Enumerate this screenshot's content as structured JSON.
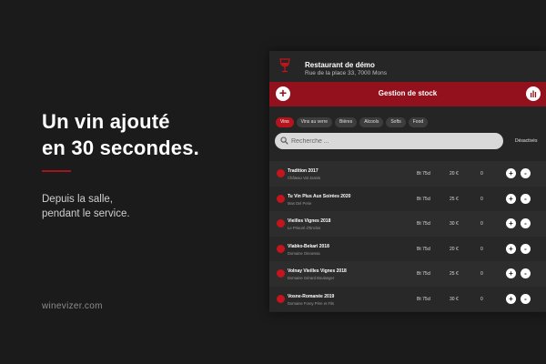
{
  "promo": {
    "headline": [
      "Un vin ajouté",
      "en 30 secondes."
    ],
    "subtext": [
      "Depuis la salle,",
      "pendant le service."
    ],
    "site": "winevizer.com",
    "accent_color": "#a4141e"
  },
  "app": {
    "restaurant_name": "Restaurant de démo",
    "restaurant_address": "Rue de la place 33, 7000 Mons",
    "title": "Gestion de stock",
    "add_label": "+",
    "brand_color": "#93111c",
    "icons": {
      "add": "plus-icon",
      "stats": "bar-chart-icon",
      "search": "search-icon",
      "logo": "wine-glass-icon"
    },
    "categories": [
      {
        "label": "Vins",
        "active": true
      },
      {
        "label": "Vins au verre",
        "active": false
      },
      {
        "label": "Bières",
        "active": false
      },
      {
        "label": "Alcools",
        "active": false
      },
      {
        "label": "Softs",
        "active": false
      },
      {
        "label": "Food",
        "active": false
      }
    ],
    "search": {
      "placeholder": "Recherche ..."
    },
    "deactivate_label": "Désactivés",
    "wines": [
      {
        "name": "Tradition 2017",
        "producer": "Château Val Joanis",
        "size": "Bt 75cl",
        "price": "20 €",
        "qty": "0"
      },
      {
        "name": "Tu Vin Plus Aux Soirées 2020",
        "producer": "Mas Del Perie",
        "size": "Bt 75cl",
        "price": "25 €",
        "qty": "0"
      },
      {
        "name": "Vieilles Vignes 2018",
        "producer": "Le Prieuré d'Enclos",
        "size": "Bt 75cl",
        "price": "30 €",
        "qty": "0"
      },
      {
        "name": "Vlabko-Bekari 2018",
        "producer": "Domaine Oinoessa",
        "size": "Bt 75cl",
        "price": "20 €",
        "qty": "0"
      },
      {
        "name": "Volnay Vieilles Vignes 2018",
        "producer": "Domaine Gérard Boulanger",
        "size": "Bt 75cl",
        "price": "25 €",
        "qty": "0"
      },
      {
        "name": "Vosne-Romanée 2019",
        "producer": "Domaine Forey Père et Fils",
        "size": "Bt 75cl",
        "price": "30 €",
        "qty": "0"
      }
    ],
    "row_plus": "+",
    "row_minus": "-"
  }
}
